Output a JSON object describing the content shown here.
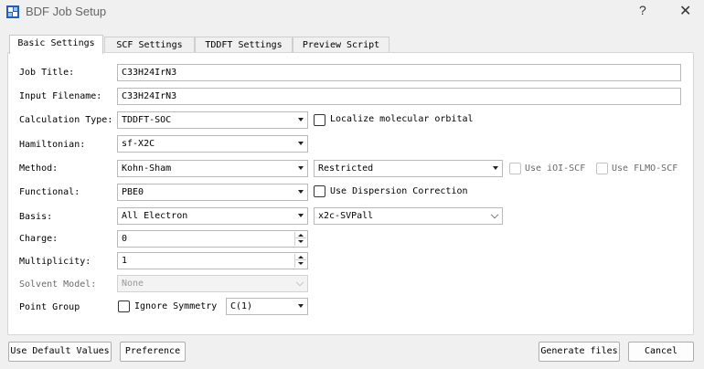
{
  "window": {
    "title": "BDF Job Setup",
    "help_glyph": "?",
    "close_glyph": "✕"
  },
  "tabs": [
    {
      "label": "Basic Settings",
      "active": true
    },
    {
      "label": "SCF Settings",
      "active": false
    },
    {
      "label": "TDDFT Settings",
      "active": false
    },
    {
      "label": "Preview Script",
      "active": false
    }
  ],
  "form": {
    "job_title": {
      "label": "Job Title:",
      "value": "C33H24IrN3"
    },
    "input_filename": {
      "label": "Input Filename:",
      "value": "C33H24IrN3"
    },
    "calculation_type": {
      "label": "Calculation Type:",
      "value": "TDDFT-SOC"
    },
    "localize_orbital": {
      "label": "Localize molecular orbital",
      "checked": false
    },
    "hamiltonian": {
      "label": "Hamiltonian:",
      "value": "sf-X2C"
    },
    "method": {
      "label": "Method:",
      "value": "Kohn-Sham",
      "restriction": "Restricted"
    },
    "use_ioi_scf": {
      "label": "Use iOI-SCF",
      "checked": false,
      "enabled": false
    },
    "use_flmo_scf": {
      "label": "Use FLMO-SCF",
      "checked": false,
      "enabled": false
    },
    "functional": {
      "label": "Functional:",
      "value": "PBE0"
    },
    "dispersion": {
      "label": "Use Dispersion Correction",
      "checked": false
    },
    "basis": {
      "label": "Basis:",
      "value": "All Electron",
      "basis_set": "x2c-SVPall"
    },
    "charge": {
      "label": "Charge:",
      "value": "0"
    },
    "multiplicity": {
      "label": "Multiplicity:",
      "value": "1"
    },
    "solvent_model": {
      "label": "Solvent Model:",
      "value": "None",
      "enabled": false
    },
    "point_group": {
      "label": "Point Group",
      "ignore_symmetry_label": "Ignore Symmetry",
      "ignore_symmetry_checked": false,
      "value": "C(1)"
    }
  },
  "buttons": {
    "use_default": "Use Default Values",
    "preference": "Preference",
    "generate": "Generate files",
    "cancel": "Cancel"
  },
  "colors": {
    "window_bg": "#f0f0f0",
    "panel_bg": "#ffffff",
    "icon_blue": "#1f5fb4"
  }
}
